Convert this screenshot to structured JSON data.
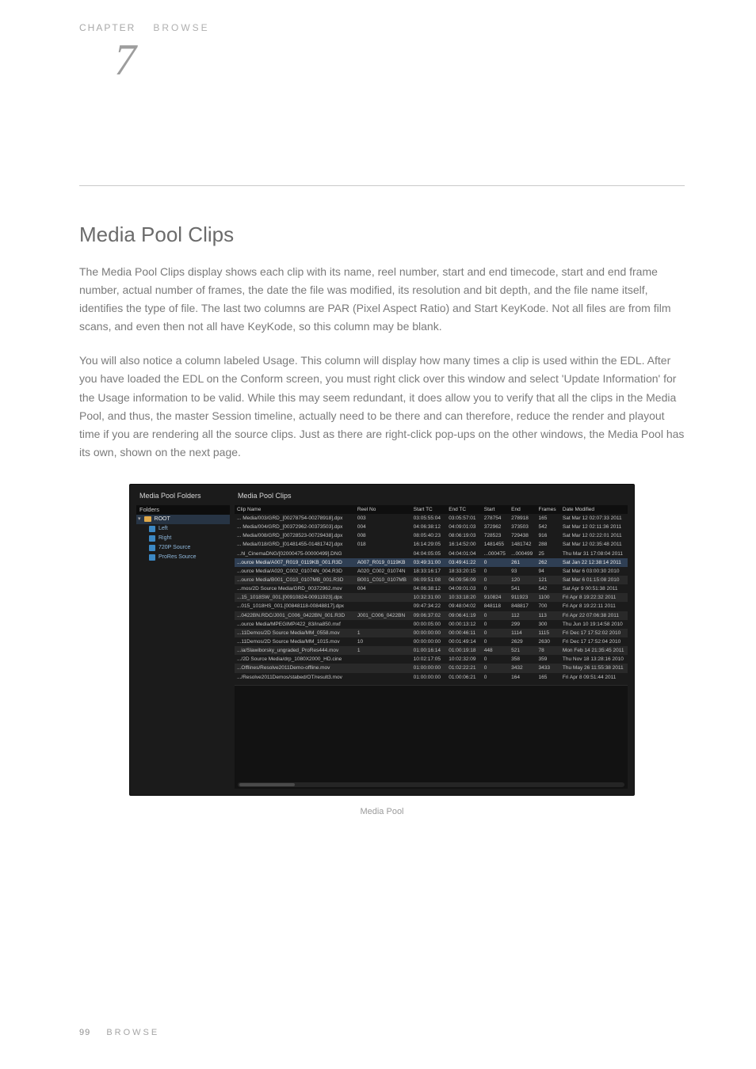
{
  "chapter_label": "CHAPTER",
  "top_browse": "BROWSE",
  "chapter_number": "7",
  "section_title": "Media Pool Clips",
  "para1": "The Media Pool Clips display shows each clip with its name, reel number, start and end timecode, start and end frame number, actual number of frames, the date the file was modified, its resolution and bit depth, and the file name itself, identifies the type of file. The last two columns are PAR (Pixel Aspect Ratio) and Start KeyKode. Not all files are from film scans, and even then not all have KeyKode, so this column may be blank.",
  "para2": "You will also notice a column labeled Usage. This column will display how many times a clip is used within the EDL. After you have loaded the EDL on the Conform screen, you must right click over this window and select 'Update Information' for the Usage information to be valid. While this may seem redundant, it does allow you to verify that all the clips in the Media Pool, and thus, the master Session timeline, actually need to be there and can therefore, reduce the render and playout time if you are rendering all the source clips. Just as there are right-click pop-ups on the other windows, the Media Pool has its own, shown on the next page.",
  "caption": "Media Pool",
  "footer_page": "99",
  "footer_label": "BROWSE",
  "screenshot": {
    "folders_title": "Media Pool Folders",
    "clips_title": "Media Pool Clips",
    "folders_header": "Folders",
    "root_name": "ROOT",
    "subfolders": [
      "Left",
      "Right",
      "720P Source",
      "ProRes Source"
    ],
    "cols": [
      "Clip Name",
      "Reel No",
      "Start TC",
      "End TC",
      "Start",
      "End",
      "Frames",
      "Date Modified"
    ],
    "rows": [
      {
        "name": "... Media/003/GRD_[00278754-00278918].dpx",
        "reel": "003",
        "stc": "03:05:55:04",
        "etc": "03:05:57:01",
        "start": "278754",
        "end": "278918",
        "frames": "165",
        "date": "Sat Mar 12 02:07:33 2011"
      },
      {
        "name": "... Media/004/GRD_[00372962-00373503].dpx",
        "reel": "004",
        "stc": "04:06:38:12",
        "etc": "04:09:01:03",
        "start": "372962",
        "end": "373503",
        "frames": "542",
        "date": "Sat Mar 12 02:11:36 2011"
      },
      {
        "name": "... Media/008/GRD_[00728523-00729438].dpx",
        "reel": "008",
        "stc": "08:05:40:23",
        "etc": "08:06:19:03",
        "start": "728523",
        "end": "729438",
        "frames": "916",
        "date": "Sat Mar 12 02:22:01 2011"
      },
      {
        "name": "... Media/018/GRD_[01481455-01481742].dpx",
        "reel": "018",
        "stc": "16:14:29:05",
        "etc": "16:14:52:00",
        "start": "1481455",
        "end": "1481742",
        "frames": "288",
        "date": "Sat Mar 12 02:35:48 2011"
      },
      {
        "name": "...hl_CinemaDNG/[02000475-00000499].DNG",
        "reel": "",
        "stc": "04:04:05:05",
        "etc": "04:04:01:04",
        "start": "...000475",
        "end": "...000499",
        "frames": "25",
        "date": "Thu Mar 31 17:08:04 2011"
      },
      {
        "name": "...ource Media/A007_R019_0119KB_001.R3D",
        "reel": "A007_R019_0119KB",
        "stc": "03:49:31:00",
        "etc": "03:49:41:22",
        "start": "0",
        "end": "261",
        "frames": "262",
        "date": "Sat Jan 22 12:38:14 2011",
        "sel": true
      },
      {
        "name": "...ource Media/A020_C002_01074N_004.R3D",
        "reel": "A020_C002_01074N",
        "stc": "18:33:16:17",
        "etc": "18:33:20:15",
        "start": "0",
        "end": "93",
        "frames": "94",
        "date": "Sat Mar  6 03:00:30 2010"
      },
      {
        "name": "...ource Media/B001_C010_0107MB_001.R3D",
        "reel": "B001_C010_0107MB",
        "stc": "06:09:51:08",
        "etc": "06:09:56:09",
        "start": "0",
        "end": "120",
        "frames": "121",
        "date": "Sat Mar  6 01:15:08 2010"
      },
      {
        "name": "...mos/2D Source Media/GRD_00372962.mov",
        "reel": "004",
        "stc": "04:06:38:12",
        "etc": "04:09:01:03",
        "start": "0",
        "end": "541",
        "frames": "542",
        "date": "Sat Apr  9 00:51:38 2011"
      },
      {
        "name": "...15_1018SW_001.[00910824-00911923].dpx",
        "reel": "",
        "stc": "10:32:31:00",
        "etc": "10:33:18:20",
        "start": "910824",
        "end": "911923",
        "frames": "1100",
        "date": "Fri Apr  8 19:22:32 2011"
      },
      {
        "name": "...015_1018HS_001.[00848118-00848817].dpx",
        "reel": "",
        "stc": "09:47:34:22",
        "etc": "09:48:04:02",
        "start": "848118",
        "end": "848817",
        "frames": "700",
        "date": "Fri Apr  8 19:22:11 2011"
      },
      {
        "name": "...0422BN.RDC/J001_C006_0422BN_001.R3D",
        "reel": "J001_C006_0422BN",
        "stc": "09:06:37:02",
        "etc": "09:06:41:19",
        "start": "0",
        "end": "112",
        "frames": "113",
        "date": "Fri Apr 22 07:06:38 2011"
      },
      {
        "name": "...ource Media/MPEGIMP/422_83/ina850.mxf",
        "reel": "",
        "stc": "00:00:05:00",
        "etc": "00:00:13:12",
        "start": "0",
        "end": "299",
        "frames": "300",
        "date": "Thu Jun 10 19:14:58 2010"
      },
      {
        "name": "...11Demos/2D Source Media/MM_0558.mov",
        "reel": "1",
        "stc": "00:00:00:00",
        "etc": "00:00:46:11",
        "start": "0",
        "end": "1114",
        "frames": "1115",
        "date": "Fri Dec 17 17:52:02 2010"
      },
      {
        "name": "...11Demos/2D Source Media/MM_1015.mov",
        "reel": "10",
        "stc": "00:00:00:00",
        "etc": "00:01:49:14",
        "start": "0",
        "end": "2629",
        "frames": "2630",
        "date": "Fri Dec 17 17:52:04 2010"
      },
      {
        "name": "...ia/Slawiborsky_ungraded_ProRes444.mov",
        "reel": "1",
        "stc": "01:00:16:14",
        "etc": "01:00:19:18",
        "start": "448",
        "end": "521",
        "frames": "78",
        "date": "Mon Feb 14 21:35:45 2011"
      },
      {
        "name": ".../2D Source Media/drp_1080X2000_HD.cine",
        "reel": "",
        "stc": "10:02:17:05",
        "etc": "10:02:32:09",
        "start": "0",
        "end": "358",
        "frames": "359",
        "date": "Thu Nov 18 13:28:16 2010"
      },
      {
        "name": "...Offlines/Resolve2011Demo-offline.mov",
        "reel": "",
        "stc": "01:00:00:00",
        "etc": "01:02:22:21",
        "start": "0",
        "end": "3432",
        "frames": "3433",
        "date": "Thu May 26 11:55:38 2011"
      },
      {
        "name": ".../Resolve2011Demos/stabed/OT/result3.mov",
        "reel": "",
        "stc": "01:00:00:00",
        "etc": "01:00:06:21",
        "start": "0",
        "end": "164",
        "frames": "165",
        "date": "Fri Apr  8 09:51:44 2011"
      }
    ]
  }
}
